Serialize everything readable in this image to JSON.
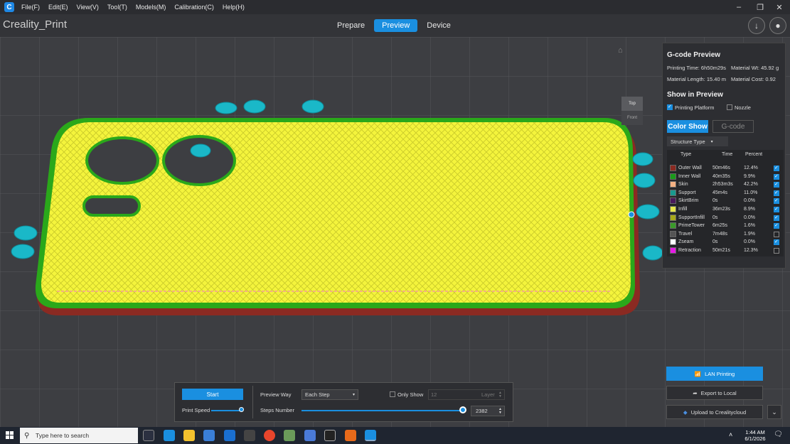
{
  "menu": {
    "items": [
      "File(F)",
      "Edit(E)",
      "View(V)",
      "Tool(T)",
      "Models(M)",
      "Calibration(C)",
      "Help(H)"
    ],
    "logo_letter": "C"
  },
  "header": {
    "app_title": "Creality_Print",
    "tabs": [
      {
        "label": "Prepare",
        "active": false
      },
      {
        "label": "Preview",
        "active": true
      },
      {
        "label": "Device",
        "active": false
      }
    ],
    "download_icon": "download-icon",
    "account_icon": "user-icon"
  },
  "view_cube": {
    "top_label": "Top",
    "front_label": "Front"
  },
  "gcode_panel": {
    "title": "G-code Preview",
    "printing_time": "Printing Time: 6h50m29s",
    "material_wt": "Material Wt: 45.92 g",
    "material_length": "Material Length: 15.40 m",
    "material_cost": "Material Cost: 0.92",
    "show_title": "Show in Preview",
    "printing_platform": {
      "label": "Printing Platform",
      "checked": true
    },
    "nozzle": {
      "label": "Nozzle",
      "checked": false
    },
    "color_show_label": "Color Show",
    "gcode_label": "G-code",
    "structure_select": "Structure Type",
    "table_headers": {
      "type": "Type",
      "time": "Time",
      "percent": "Percent"
    },
    "rows": [
      {
        "type": "Outer Wall",
        "time": "50m46s",
        "percent": "12.4%",
        "color": "#8b2a22",
        "checked": true
      },
      {
        "type": "Inner Wall",
        "time": "40m35s",
        "percent": "9.9%",
        "color": "#1a9a1a",
        "checked": true
      },
      {
        "type": "Skin",
        "time": "2h53m3s",
        "percent": "42.2%",
        "color": "#f4b183",
        "checked": true
      },
      {
        "type": "Support",
        "time": "45m4s",
        "percent": "11.0%",
        "color": "#1a9a8f",
        "checked": true
      },
      {
        "type": "SkirtBrim",
        "time": "0s",
        "percent": "0.0%",
        "color": "#4a1a5c",
        "checked": true
      },
      {
        "type": "Infill",
        "time": "36m23s",
        "percent": "8.9%",
        "color": "#e6e64c",
        "checked": true
      },
      {
        "type": "SupportInfill",
        "time": "0s",
        "percent": "0.0%",
        "color": "#a8a81a",
        "checked": true
      },
      {
        "type": "PrimeTower",
        "time": "6m25s",
        "percent": "1.6%",
        "color": "#3a9a2a",
        "checked": true
      },
      {
        "type": "Travel",
        "time": "7m48s",
        "percent": "1.9%",
        "color": "#555555",
        "checked": false
      },
      {
        "type": "Zseam",
        "time": "0s",
        "percent": "0.0%",
        "color": "#ffffff",
        "checked": true
      },
      {
        "type": "Retraction",
        "time": "50m21s",
        "percent": "12.3%",
        "color": "#e61ae6",
        "checked": false
      }
    ]
  },
  "bottom_panel": {
    "start_label": "Start",
    "print_speed_label": "Print Speed",
    "preview_way_label": "Preview Way",
    "preview_way_value": "Each Step",
    "only_show_label": "Only Show",
    "layer_value": "12",
    "layer_label": "Layer",
    "steps_number_label": "Steps Number",
    "steps_value": "2382",
    "steps_fraction": 1.0
  },
  "right_buttons": {
    "lan_printing": "LAN Printing",
    "export_local": "Export to Local",
    "upload_cloud": "Upload to Crealitycloud"
  },
  "taskbar": {
    "search_placeholder": "Type here to search",
    "time": "1:44 AM",
    "date": "6/1/2026"
  },
  "colors": {
    "accent": "#1a8fe0",
    "infill_yellow": "#f2f23a",
    "wall_green": "#2aa81a",
    "wall_red": "#8b2a22",
    "support_cyan": "#1ab8c8"
  }
}
